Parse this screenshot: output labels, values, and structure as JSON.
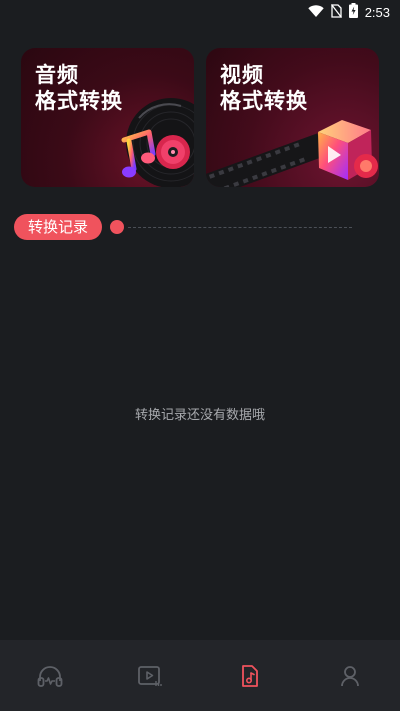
{
  "status_bar": {
    "time": "2:53",
    "icons": [
      "wifi-icon",
      "no-sim-icon",
      "battery-charging-icon"
    ]
  },
  "cards": [
    {
      "id": "audio",
      "title_line1": "音频",
      "title_line2": "格式转换",
      "art": [
        "vinyl-record-icon",
        "music-note-icon",
        "cd-icon"
      ]
    },
    {
      "id": "video",
      "title_line1": "视频",
      "title_line2": "格式转换",
      "art": [
        "film-strip-icon",
        "play-cube-icon"
      ]
    }
  ],
  "history": {
    "title": "转换记录",
    "empty_text": "转换记录还没有数据哦"
  },
  "bottom_nav": {
    "items": [
      {
        "icon": "headphones-icon",
        "active": false
      },
      {
        "icon": "video-play-icon",
        "active": false
      },
      {
        "icon": "music-file-icon",
        "active": true
      },
      {
        "icon": "profile-icon",
        "active": false
      }
    ]
  },
  "colors": {
    "background": "#1b1d20",
    "accent": "#f0535d",
    "nav_background": "#232529",
    "nav_inactive": "#5e6167"
  }
}
